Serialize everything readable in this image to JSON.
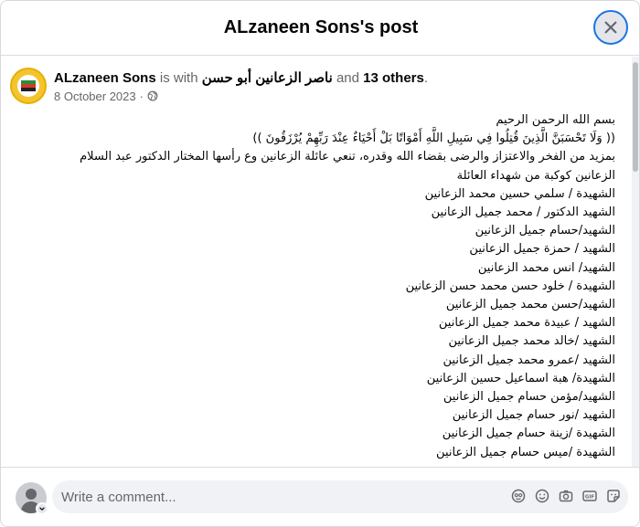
{
  "dialog": {
    "title": "ALzaneen Sons's post"
  },
  "post": {
    "author": "ALzaneen Sons",
    "with_text": " is with ",
    "tagged_person": "ناصر الزعانين أبو حسن",
    "and_text": " and ",
    "others": "13 others",
    "period": ".",
    "date": "8 October 2023",
    "date_sep": " · ",
    "body_lines": [
      "بسم الله الرحمن الرحيم",
      "(( وَلَا تَحْسَبَنَّ الَّذِينَ قُتِلُوا فِي سَبِيلِ اللَّهِ أَمْوَاتًا بَلْ أَحْيَاءٌ عِنْدَ رَبِّهِمْ يُرْزَقُونَ ))",
      "بمزيد من الفخر والاعتزاز والرضى بقضاء الله وقدره، تنعي عائلة الزعانين وع رأسها المختار الدكتور عبد السلام",
      "الزعانين كوكبة من شهداء العائلة",
      "الشهيدة / سلمي حسين محمد الزعانين",
      "الشهيد الدكتور / محمد جميل الزعانين",
      "الشهيد/حسام جميل الزعانين",
      "الشهيد / حمزة جميل الزعانين",
      "الشهيد/  انس محمد الزعانين",
      "الشهيدة / خلود حسن محمد حسن الزعانين",
      "الشهيد/حسن محمد جميل الزعانين",
      "الشهيد / عبيدة محمد جميل الزعانين",
      "الشهيد /خالد محمد جميل الزعانين",
      "الشهيد /عمرو محمد جميل الزعانين",
      "الشهيدة/ هبة اسماعيل حسين الزعانين",
      "الشهيد/مؤمن حسام جميل الزعانين",
      "الشهيد /نور حسام جميل الزعانين",
      "الشهيدة /زينة حسام جميل الزعانين",
      "الشهيدة /ميس حسام جميل الزعانين"
    ]
  },
  "comment": {
    "placeholder": "Write a comment..."
  },
  "icons": {
    "close": "close-icon",
    "globe": "globe-icon",
    "sticker": "sticker-icon",
    "emoji": "emoji-icon",
    "camera": "camera-icon",
    "gif": "gif-icon",
    "avatar_sticker": "avatar-sticker-icon"
  },
  "colors": {
    "accent": "#1b74e4",
    "secondary_text": "#65676b",
    "input_bg": "#f0f2f5"
  }
}
